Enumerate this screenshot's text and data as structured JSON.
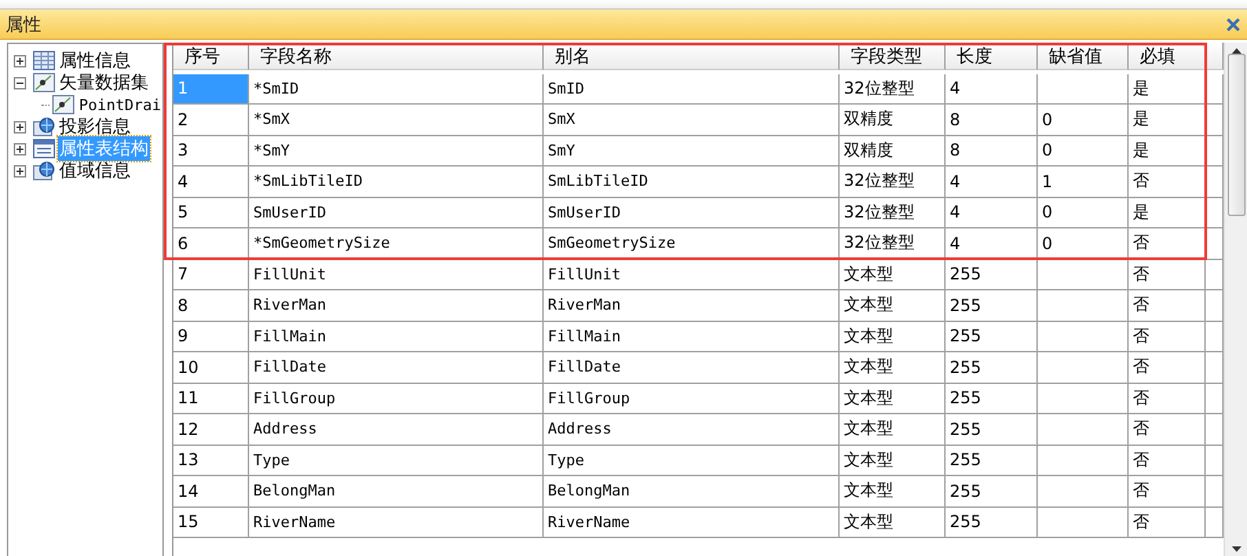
{
  "window": {
    "title": "属性"
  },
  "tree": [
    {
      "label": "属性信息",
      "kind": "table",
      "expanded": false,
      "selected": false
    },
    {
      "label": "矢量数据集",
      "kind": "dataset",
      "expanded": true,
      "selected": false,
      "children": [
        {
          "label": "PointDrai",
          "kind": "dataset",
          "selected": false
        }
      ]
    },
    {
      "label": "投影信息",
      "kind": "globe",
      "expanded": false,
      "selected": false
    },
    {
      "label": "属性表结构",
      "kind": "form",
      "expanded": false,
      "selected": true
    },
    {
      "label": "值域信息",
      "kind": "globe",
      "expanded": false,
      "selected": false
    }
  ],
  "table": {
    "columns": [
      "序号",
      "字段名称",
      "别名",
      "字段类型",
      "长度",
      "缺省值",
      "必填"
    ],
    "highlight_frame": true,
    "rows": [
      {
        "cells": [
          "1",
          "*SmID",
          "SmID",
          "32位整型",
          "4",
          "",
          "是"
        ],
        "selected": true
      },
      {
        "cells": [
          "2",
          "*SmX",
          "SmX",
          "双精度",
          "8",
          "0",
          "是"
        ],
        "selected": false
      },
      {
        "cells": [
          "3",
          "*SmY",
          "SmY",
          "双精度",
          "8",
          "0",
          "是"
        ],
        "selected": false
      },
      {
        "cells": [
          "4",
          "*SmLibTileID",
          "SmLibTileID",
          "32位整型",
          "4",
          "1",
          "否"
        ],
        "selected": false
      },
      {
        "cells": [
          "5",
          "SmUserID",
          "SmUserID",
          "32位整型",
          "4",
          "0",
          "是"
        ],
        "selected": false
      },
      {
        "cells": [
          "6",
          "*SmGeometrySize",
          "SmGeometrySize",
          "32位整型",
          "4",
          "0",
          "否"
        ],
        "selected": false
      },
      {
        "cells": [
          "7",
          "FillUnit",
          "FillUnit",
          "文本型",
          "255",
          "",
          "否"
        ],
        "selected": false
      },
      {
        "cells": [
          "8",
          "RiverMan",
          "RiverMan",
          "文本型",
          "255",
          "",
          "否"
        ],
        "selected": false
      },
      {
        "cells": [
          "9",
          "FillMain",
          "FillMain",
          "文本型",
          "255",
          "",
          "否"
        ],
        "selected": false
      },
      {
        "cells": [
          "10",
          "FillDate",
          "FillDate",
          "文本型",
          "255",
          "",
          "否"
        ],
        "selected": false
      },
      {
        "cells": [
          "11",
          "FillGroup",
          "FillGroup",
          "文本型",
          "255",
          "",
          "否"
        ],
        "selected": false
      },
      {
        "cells": [
          "12",
          "Address",
          "Address",
          "文本型",
          "255",
          "",
          "否"
        ],
        "selected": false
      },
      {
        "cells": [
          "13",
          "Type",
          "Type",
          "文本型",
          "255",
          "",
          "否"
        ],
        "selected": false
      },
      {
        "cells": [
          "14",
          "BelongMan",
          "BelongMan",
          "文本型",
          "255",
          "",
          "否"
        ],
        "selected": false
      },
      {
        "cells": [
          "15",
          "RiverName",
          "RiverName",
          "文本型",
          "255",
          "",
          "否"
        ],
        "selected": false
      }
    ]
  }
}
